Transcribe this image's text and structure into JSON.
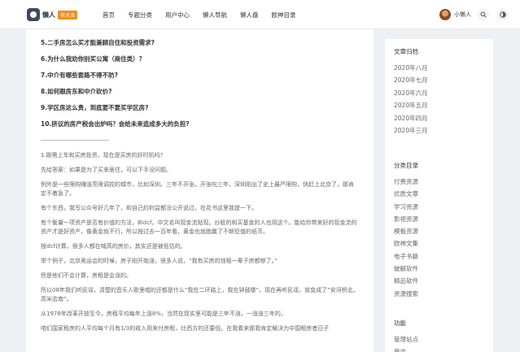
{
  "logo": {
    "name": "懒人",
    "badge": "技术派"
  },
  "nav": [
    "首页",
    "专题分类",
    "用户中心",
    "懒人导航",
    "懒人盘",
    "欧神目录"
  ],
  "user": {
    "name": "小懒人"
  },
  "icons": {
    "search": "search-icon",
    "theme": "theme-toggle-icon"
  },
  "questions": [
    "5.二手房怎么买才能兼顾自住和投资需求?",
    "6.为什么我劝你别买公寓（商住类）？",
    "7.中介有哪些套路不得不防?",
    "8.如何跟房东和中介砍价?",
    "9.学区房这么贵，到底要不要买学区房?",
    "10.挤议的房产税会出炉吗？会给未来造成多大的负担?"
  ],
  "paragraphs": [
    "1.刚需上车和买房投资，现在是买房的好时机吗?",
    "先给答案：如果是为了买来居住，可以下手没问题。",
    "例外是一些限购赚涨亮限调控的城市，比如深圳。三年不开张，开张吃三年，深圳刚出了史上最严限购，快赶上北京了，那肯定不着急了。",
    "有个东西，我写公众号好几年了，和自己的利益都没公开说过，在花书这里我提一下。",
    "有个衡量一项资产是否有价值的方法，Bldcf。中文名叫现金流贴现。炒股的和买基金的人也用这个。能给你带来好的现金流的资产才是好资产，像黄金就不行，所以按过去一百年看，黄金也就跑赢了不断贬值的纸币。",
    "按dcf计算，很多人都在喊高的房价，其实还是被低估的。",
    "举个例子，北京奥运会的时候，房子刚开始涨，很多人说，“我有买房的钱租一辈子房都够了。”",
    "但是他们不会计算，房租是会涨的。",
    "所以08年我们听民谣，清楚的音乐人歌里唱的还都是什么“我在二环路上，我在钟鼓楼”，现在再听民谣，就变成了“安河桥北，高米店南”。",
    "从1978年改革开放至今，房租平均每年上涨8%，当然在现实里可能是三年不涨，一涨涨三年的。",
    "咱们国家租房的人平均每个月有1/3的收入用来付房租，比西方的还要低。在我看来那我肯定解决为中国租房者日子"
  ],
  "sidebar": {
    "archive_title": "文章归档",
    "archive": [
      "2020年八月",
      "2020年七月",
      "2020年六月",
      "2020年五月",
      "2020年四月",
      "2020年三月"
    ],
    "category_title": "分类目录",
    "categories": [
      "付费资源",
      "优质文章",
      "学习资源",
      "影视资源",
      "模板资源",
      "欧神文集",
      "电子书籍",
      "破解软件",
      "精品软件",
      "资源搜索"
    ],
    "function_title": "功能",
    "functions": [
      "管理站点",
      "登出"
    ]
  }
}
